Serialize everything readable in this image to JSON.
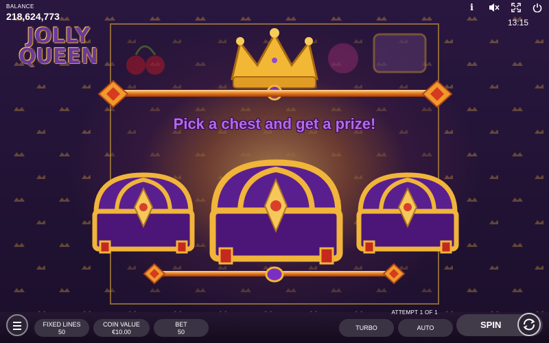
{
  "hud": {
    "balance_label": "BALANCE",
    "balance_value": "218,624,773",
    "info_icon": "i",
    "clock": "13:15"
  },
  "logo": {
    "line1": "JOLLY",
    "line2": "QUEEN"
  },
  "bonus": {
    "headline": "Pick a chest and get a prize!",
    "attempt": "ATTEMPT 1 OF 1"
  },
  "controls": {
    "fixed_lines_label": "FIXED LINES",
    "fixed_lines_value": "50",
    "coin_value_label": "COIN VALUE",
    "coin_value_value": "€10.00",
    "bet_label": "BET",
    "bet_value": "50",
    "turbo_label": "TURBO",
    "auto_label": "AUTO",
    "spin_label": "SPIN"
  },
  "colors": {
    "headline": "#b46be8",
    "chest_purple": "#5a1f8f",
    "chest_gold": "#f0b53a",
    "background": "#1e1030"
  },
  "icons": [
    "info-icon",
    "mute-icon",
    "fullscreen-icon",
    "power-icon",
    "menu-icon",
    "crown-icon",
    "chest-icon",
    "autoplay-cycle-icon"
  ]
}
